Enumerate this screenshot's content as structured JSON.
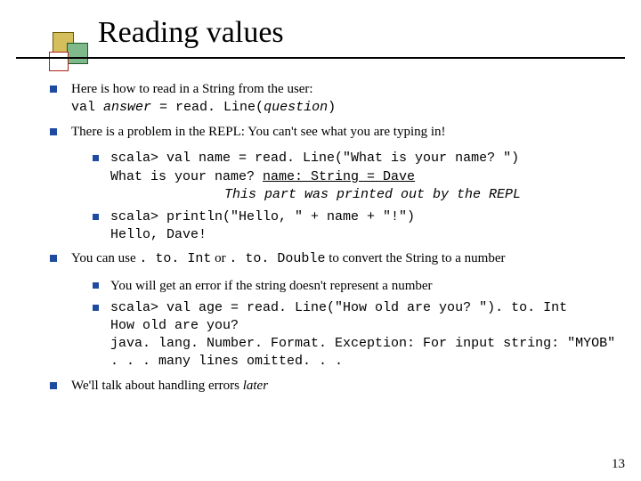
{
  "title": "Reading values",
  "page_number": "13",
  "b1": {
    "text": "Here is how to read in a String from the user:",
    "code_pre": "val ",
    "code_answer": "answer",
    "code_mid": " = read. Line(",
    "code_question": "question",
    "code_post": ")"
  },
  "b2": {
    "text": "There is a problem in the REPL: You can't see what you are typing in!",
    "s1_line1": "scala> val name = read. Line(\"What is your name? \")",
    "s1_line2a": "What is your name? ",
    "s1_line2b": "name: String = Dave",
    "s1_note": "This part was printed out by the REPL",
    "s2_line1": "scala> println(\"Hello, \" + name + \"!\")",
    "s2_line2": "Hello, Dave!"
  },
  "b3": {
    "pre": "You can use ",
    "c1": ". to. Int",
    "mid": " or ",
    "c2": ". to. Double",
    "post": " to convert the String to a number",
    "s1": "You will get an error if the string doesn't represent a number",
    "s2_line1": "scala> val age = read. Line(\"How old are you? \"). to. Int",
    "s2_line2": "How old are you?",
    "s2_line3": "java. lang. Number. Format. Exception: For input string: \"MYOB\"",
    "s2_line4": ". . . many lines omitted. . ."
  },
  "b4": {
    "pre": "We'll talk about handling errors ",
    "em": "later"
  }
}
